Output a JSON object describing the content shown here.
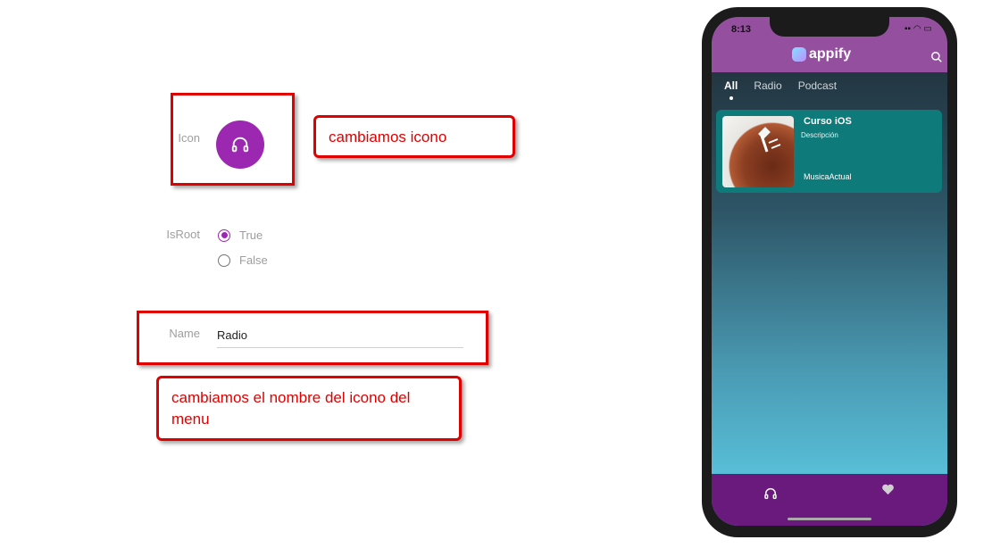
{
  "form": {
    "icon_label": "Icon",
    "icon_color": "#9c27b0",
    "icon_name": "headphones-icon",
    "isroot_label": "IsRoot",
    "radio_options": [
      {
        "label": "True",
        "checked": true
      },
      {
        "label": "False",
        "checked": false
      }
    ],
    "name_label": "Name",
    "name_value": "Radio"
  },
  "annotations": {
    "callout_icon": "cambiamos icono",
    "callout_name": "cambiamos el nombre del icono del menu",
    "highlight_color": "#e00000"
  },
  "phone": {
    "time": "8:13",
    "app_name": "appify",
    "tabs": [
      "All",
      "Radio",
      "Podcast"
    ],
    "active_tab": "All",
    "card": {
      "title": "Curso iOS",
      "description": "Descripción",
      "artist": "MusicaActual"
    },
    "bottom_nav_icons": [
      "headphones-icon",
      "heart-icon"
    ],
    "colors": {
      "topbar": "#94509e",
      "card": "#0f7a7a",
      "bottombar": "#6a1a7d"
    }
  }
}
